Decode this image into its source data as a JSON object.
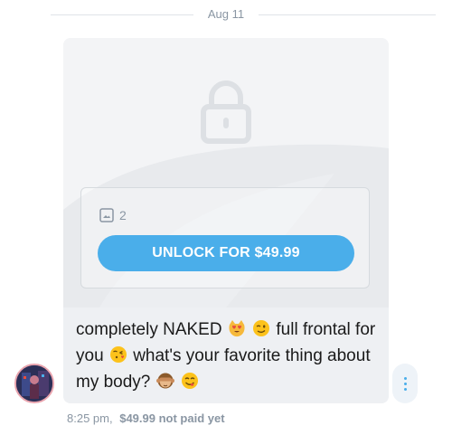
{
  "date_divider": {
    "label": "Aug 11"
  },
  "locked_post": {
    "media_count": "2",
    "unlock_button_label": "UNLOCK FOR $49.99",
    "icons": {
      "lock": "lock-icon",
      "media": "image-icon"
    }
  },
  "message": {
    "line1_a": "completely NAKED",
    "line1_b": "full frontal for",
    "line2_a": "you",
    "line2_b": "what's your favorite thing about",
    "line3_a": "my body?",
    "emojis": [
      "heart-eyes-cat-emoji",
      "winking-face-emoji",
      "face-blowing-kiss-emoji",
      "see-no-evil-monkey-emoji",
      "face-savoring-food-emoji"
    ]
  },
  "meta": {
    "time": "8:25 pm,",
    "price": "$49.99",
    "status": "not paid yet"
  },
  "colors": {
    "accent": "#4aaeea",
    "muted_text": "#8a96a3",
    "bubble_bg": "#eef0f3",
    "avatar_ring": "#e8a3ad"
  }
}
